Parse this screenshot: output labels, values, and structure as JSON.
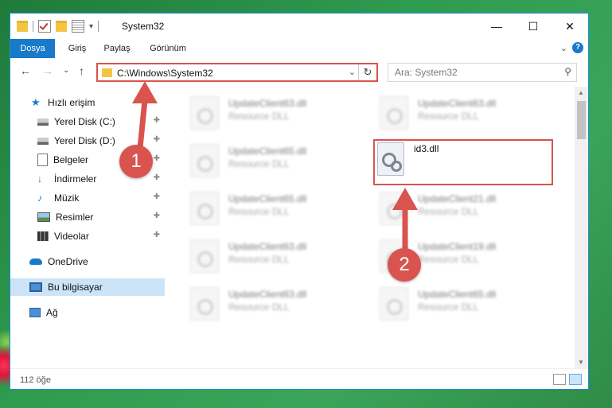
{
  "window": {
    "title": "System32",
    "minimize": "—",
    "maximize": "☐",
    "close": "✕"
  },
  "ribbon": {
    "tabs": [
      "Dosya",
      "Giriş",
      "Paylaş",
      "Görünüm"
    ],
    "collapse": "⌄",
    "help": "?"
  },
  "nav": {
    "back": "←",
    "forward": "→",
    "recent": "⌄",
    "up": "↑",
    "address": "C:\\Windows\\System32",
    "dropdown": "⌄",
    "refresh": "↻",
    "search_placeholder": "Ara: System32",
    "search_icon": "⚲"
  },
  "sidebar": {
    "items": [
      {
        "label": "Hızlı erişim",
        "icon": "star-icon",
        "pinned": false
      },
      {
        "label": "Yerel Disk (C:)",
        "icon": "drive-icon",
        "pinned": true
      },
      {
        "label": "Yerel Disk (D:)",
        "icon": "drive-icon",
        "pinned": true
      },
      {
        "label": "Belgeler",
        "icon": "document-icon",
        "pinned": true
      },
      {
        "label": "İndirmeler",
        "icon": "download-icon",
        "pinned": true
      },
      {
        "label": "Müzik",
        "icon": "music-icon",
        "pinned": true
      },
      {
        "label": "Resimler",
        "icon": "picture-icon",
        "pinned": true
      },
      {
        "label": "Videolar",
        "icon": "video-icon",
        "pinned": true
      },
      {
        "label": "OneDrive",
        "icon": "cloud-icon",
        "pinned": false
      },
      {
        "label": "Bu bilgisayar",
        "icon": "computer-icon",
        "pinned": false,
        "selected": true
      },
      {
        "label": "Ağ",
        "icon": "network-icon",
        "pinned": false
      }
    ],
    "pin_glyph": "📌"
  },
  "files": [
    {
      "name": "UpdateClient63.dll",
      "type": "Resource DLL"
    },
    {
      "name": "UpdateClient63.dll",
      "type": "Resource DLL"
    },
    {
      "name": "UpdateClient65.dll",
      "type": "Resource DLL"
    },
    {
      "name": "id3.dll",
      "type": ""
    },
    {
      "name": "UpdateClient65.dll",
      "type": "Resource DLL"
    },
    {
      "name": "UpdateClient21.dll",
      "type": "Resource DLL"
    },
    {
      "name": "UpdateClient63.dll",
      "type": "Resource DLL"
    },
    {
      "name": "UpdateClient19.dll",
      "type": "Resource DLL"
    },
    {
      "name": "UpdateClient63.dll",
      "type": "Resource DLL"
    },
    {
      "name": "UpdateClient65.dll",
      "type": "Resource DLL"
    }
  ],
  "status": {
    "count": "112 öğe"
  },
  "annotations": {
    "one": "1",
    "two": "2",
    "color": "#d9534f"
  }
}
